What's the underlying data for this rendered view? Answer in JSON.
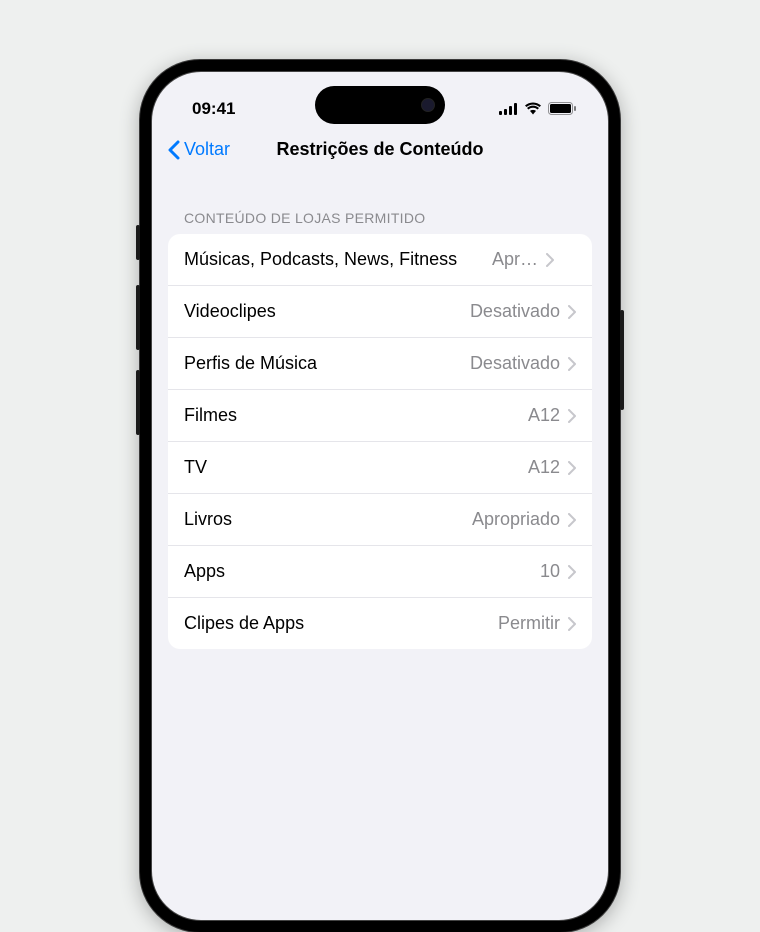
{
  "status": {
    "time": "09:41"
  },
  "nav": {
    "back_label": "Voltar",
    "title": "Restrições de Conteúdo"
  },
  "section": {
    "header": "CONTEÚDO DE LOJAS PERMITIDO",
    "rows": [
      {
        "label": "Músicas, Podcasts, News, Fitness",
        "value": "Apr…"
      },
      {
        "label": "Videoclipes",
        "value": "Desativado"
      },
      {
        "label": "Perfis de Música",
        "value": "Desativado"
      },
      {
        "label": "Filmes",
        "value": "A12"
      },
      {
        "label": "TV",
        "value": "A12"
      },
      {
        "label": "Livros",
        "value": "Apropriado"
      },
      {
        "label": "Apps",
        "value": "10"
      },
      {
        "label": "Clipes de Apps",
        "value": "Permitir"
      }
    ]
  }
}
